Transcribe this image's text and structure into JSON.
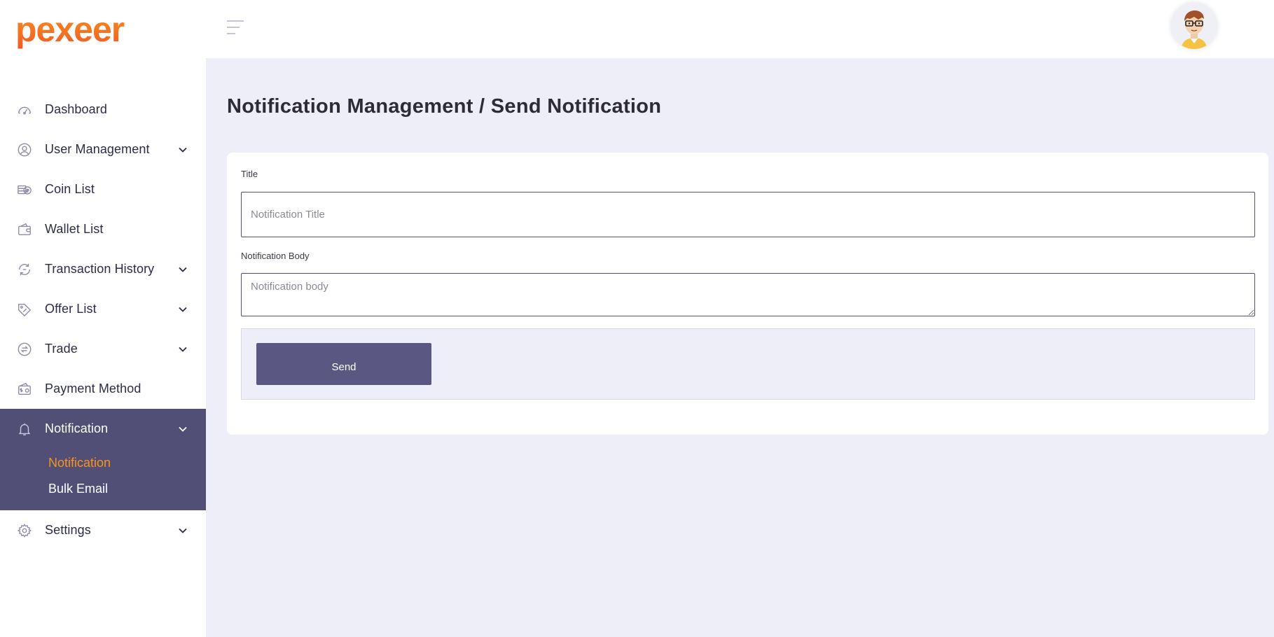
{
  "brand": {
    "name": "pexeer",
    "color": "#f7931e"
  },
  "header": {
    "menu_icon": "hamburger-icon",
    "avatar": "user-avatar"
  },
  "sidebar": {
    "items": [
      {
        "label": "Dashboard",
        "icon": "dashboard-icon",
        "has_children": false
      },
      {
        "label": "User Management",
        "icon": "user-icon",
        "has_children": true
      },
      {
        "label": "Coin List",
        "icon": "coin-icon",
        "has_children": false
      },
      {
        "label": "Wallet List",
        "icon": "wallet-icon",
        "has_children": false
      },
      {
        "label": "Transaction History",
        "icon": "transaction-icon",
        "has_children": true
      },
      {
        "label": "Offer List",
        "icon": "offer-tag-icon",
        "has_children": true
      },
      {
        "label": "Trade",
        "icon": "trade-icon",
        "has_children": true
      },
      {
        "label": "Payment Method",
        "icon": "payment-icon",
        "has_children": false
      },
      {
        "label": "Notification",
        "icon": "bell-icon",
        "has_children": true,
        "expanded": true,
        "children": [
          {
            "label": "Notification",
            "current": true
          },
          {
            "label": "Bulk Email",
            "current": false
          }
        ]
      },
      {
        "label": "Settings",
        "icon": "gear-icon",
        "has_children": true
      }
    ]
  },
  "main": {
    "title": "Notification Management  /  Send Notification",
    "form": {
      "title_label": "Title",
      "title_placeholder": "Notification Title",
      "title_value": "",
      "body_label": "Notification Body",
      "body_placeholder": "Notification body",
      "body_value": "",
      "send_label": "Send"
    }
  },
  "colors": {
    "sidebar_active": "#524f77",
    "accent": "#f7931e",
    "button": "#5a5883",
    "background": "#eeeef8"
  }
}
